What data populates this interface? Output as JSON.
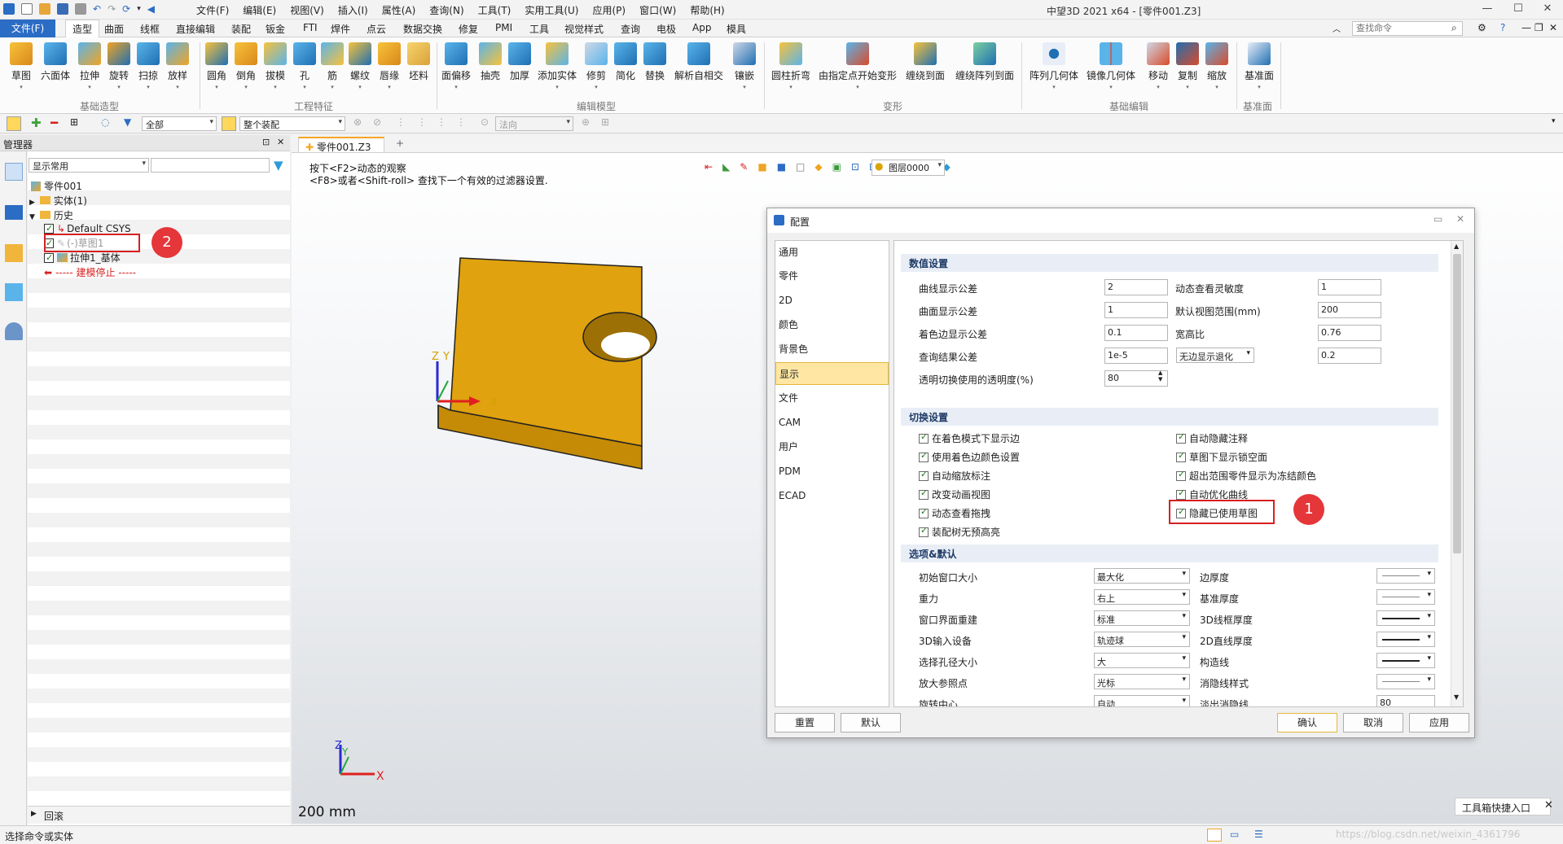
{
  "titlebar": {
    "menus": [
      "文件(F)",
      "编辑(E)",
      "视图(V)",
      "插入(I)",
      "属性(A)",
      "查询(N)",
      "工具(T)",
      "实用工具(U)",
      "应用(P)",
      "窗口(W)",
      "帮助(H)"
    ],
    "window_title": "中望3D 2021 x64 - [零件001.Z3]"
  },
  "ribbon_tabs": {
    "file": "文件(F)",
    "tabs": [
      "造型",
      "曲面",
      "线框",
      "直接编辑",
      "装配",
      "钣金",
      "FTI",
      "焊件",
      "点云",
      "数据交换",
      "修复",
      "PMI",
      "工具",
      "视觉样式",
      "查询",
      "电极",
      "App",
      "模具"
    ],
    "active": "造型",
    "search_placeholder": "查找命令"
  },
  "ribbon": {
    "groups": {
      "basic": "基础造型",
      "eng": "工程特征",
      "edit": "编辑模型",
      "deform": "变形",
      "basicedit": "基础编辑",
      "datum": "基准面"
    },
    "tools_basic": [
      "草图",
      "六面体",
      "拉伸",
      "旋转",
      "扫掠",
      "放样"
    ],
    "tools_eng": [
      "圆角",
      "倒角",
      "拔模",
      "孔",
      "筋",
      "螺纹",
      "唇缘",
      "坯料"
    ],
    "tools_edit": [
      "面偏移",
      "抽壳",
      "加厚",
      "添加实体",
      "修剪",
      "简化",
      "替换",
      "解析自相交",
      "镶嵌"
    ],
    "tools_deform": [
      "圆柱折弯",
      "由指定点开始变形",
      "缠绕到面",
      "缠绕阵列到面"
    ],
    "tools_basicedit": [
      "阵列几何体",
      "镜像几何体",
      "移动",
      "复制",
      "缩放"
    ],
    "tools_datum": [
      "基准面"
    ]
  },
  "filterbar": {
    "filter": "全部",
    "scope": "整个装配",
    "direction": "法向"
  },
  "manager": {
    "title": "管理器",
    "view_filter": "显示常用",
    "tree": {
      "root": "零件001",
      "solid": "实体(1)",
      "history": "历史",
      "csys": "Default CSYS",
      "sketch": "(-)草图1",
      "extrude": "拉伸1_基体",
      "stop": "----- 建模停止 -----"
    },
    "back": "回滚"
  },
  "document": {
    "tab": "零件001.Z3",
    "hint_line1": "按下<F2>动态的观察",
    "hint_line2": "<F8>或者<Shift-roll> 查找下一个有效的过滤器设置.",
    "layer": "图层0000",
    "scale": "200 mm",
    "triad_main": {
      "z": "Z",
      "y": "Y",
      "x": "X"
    },
    "triad_corner": {
      "z": "Z",
      "y": "Y",
      "x": "X"
    }
  },
  "dialog": {
    "title": "配置",
    "nav": [
      "通用",
      "零件",
      "2D",
      "颜色",
      "背景色",
      "显示",
      "文件",
      "CAM",
      "用户",
      "PDM",
      "ECAD"
    ],
    "nav_selected": "显示",
    "sections": {
      "values": "数值设置",
      "toggles": "切换设置",
      "options": "选项&默认"
    },
    "values": {
      "curve_tol": {
        "label": "曲线显示公差",
        "value": "2"
      },
      "surface_tol": {
        "label": "曲面显示公差",
        "value": "1"
      },
      "shade_tol": {
        "label": "着色边显示公差",
        "value": "0.1"
      },
      "query_tol": {
        "label": "查询结果公差",
        "value": "1e-5"
      },
      "transparency": {
        "label": "透明切换使用的透明度(%)",
        "value": "80"
      },
      "dyn_sens": {
        "label": "动态查看灵敏度",
        "value": "1"
      },
      "view_range": {
        "label": "默认视图范围(mm)",
        "value": "200"
      },
      "aspect": {
        "label": "宽高比",
        "value": "0.76"
      },
      "edge_degrade": {
        "label": "无边显示退化",
        "value": "0.2"
      }
    },
    "toggles_left": [
      "在着色模式下显示边",
      "使用着色边颜色设置",
      "自动缩放标注",
      "改变动画视图",
      "动态查看拖拽",
      "装配树无预高亮"
    ],
    "toggles_right": [
      "自动隐藏注释",
      "草图下显示锁空面",
      "超出范围零件显示为冻结颜色",
      "自动优化曲线",
      "隐藏已使用草图"
    ],
    "options_left": [
      {
        "label": "初始窗口大小",
        "value": "最大化"
      },
      {
        "label": "重力",
        "value": "右上"
      },
      {
        "label": "窗口界面重建",
        "value": "标准"
      },
      {
        "label": "3D输入设备",
        "value": "轨迹球"
      },
      {
        "label": "选择孔径大小",
        "value": "大"
      },
      {
        "label": "放大参照点",
        "value": "光标"
      },
      {
        "label": "旋转中心",
        "value": "自动"
      }
    ],
    "options_right": [
      "边厚度",
      "基准厚度",
      "3D线框厚度",
      "2D直线厚度",
      "构造线",
      "消隐线样式",
      "淡出消隐线"
    ],
    "options_right_last_value": "80",
    "buttons": {
      "reset": "重置",
      "default": "默认",
      "ok": "确认",
      "cancel": "取消",
      "apply": "应用"
    }
  },
  "annotations": {
    "badge1": "1",
    "badge2": "2"
  },
  "toolbox_entry": "工具箱快捷入口",
  "status": {
    "text": "选择命令或实体",
    "watermark": "https://blog.csdn.net/weixin_4361796"
  }
}
